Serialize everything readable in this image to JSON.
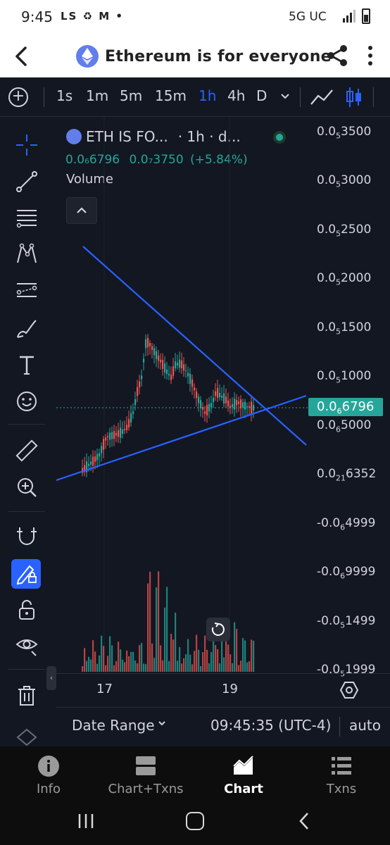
{
  "status_bar": {
    "time": "9:45",
    "notifications": "LS ♻ M •",
    "network": "5G UC"
  },
  "header": {
    "title": "Ethereum is for everyone",
    "back_icon": "back-arrow-icon",
    "share_icon": "share-icon",
    "more_icon": "more-vertical-icon"
  },
  "timeframes": {
    "items": [
      "1s",
      "1m",
      "5m",
      "15m",
      "1h",
      "4h",
      "D"
    ],
    "active": "1h",
    "dropdown_icon": "chevron-down-icon",
    "chart_type_icons": [
      "line-chart-icon",
      "candlestick-icon"
    ]
  },
  "toolbar": {
    "tools": [
      "crosshair-icon",
      "trend-line-icon",
      "fib-levels-icon",
      "pattern-icon",
      "forecast-icon",
      "brush-icon",
      "text-icon",
      "emoji-icon",
      "ruler-icon",
      "zoom-in-icon",
      "magnet-icon",
      "lock-drawing-icon",
      "unlock-icon",
      "eye-icon",
      "trash-icon"
    ]
  },
  "legend": {
    "symbol": "ETH IS FO...",
    "interval": "· 1h · d...",
    "price": "0.0₆6796",
    "change_abs": "0.0₇3750",
    "change_pct": "(+5.84%)",
    "indicator": "Volume"
  },
  "price_axis": {
    "labels": [
      {
        "main": "0.0",
        "sub": "5",
        "tail": "3500"
      },
      {
        "main": "0.0",
        "sub": "5",
        "tail": "3000"
      },
      {
        "main": "0.0",
        "sub": "5",
        "tail": "2500"
      },
      {
        "main": "0.0",
        "sub": "5",
        "tail": "2000"
      },
      {
        "main": "0.0",
        "sub": "5",
        "tail": "1500"
      },
      {
        "main": "0.0",
        "sub": "5",
        "tail": "1000"
      },
      {
        "main": "0.0",
        "sub": "6",
        "tail": "5000"
      },
      {
        "main": "0.0",
        "sub": "21",
        "tail": "6352"
      },
      {
        "main": "-0.0",
        "sub": "6",
        "tail": "4999"
      },
      {
        "main": "-0.0",
        "sub": "6",
        "tail": "9999"
      },
      {
        "main": "-0.0",
        "sub": "5",
        "tail": "1499"
      },
      {
        "main": "-0.0",
        "sub": "5",
        "tail": "1999"
      }
    ],
    "current": {
      "main": "0.0",
      "sub": "6",
      "tail": "6796"
    }
  },
  "time_axis": {
    "labels": [
      "17",
      "19"
    ]
  },
  "footer": {
    "date_range": "Date Range",
    "clock": "09:45:35 (UTC-4)",
    "scale": "auto"
  },
  "bottom_nav": {
    "items": [
      {
        "label": "Info",
        "icon": "info-icon"
      },
      {
        "label": "Chart+Txns",
        "icon": "split-view-icon"
      },
      {
        "label": "Chart",
        "icon": "area-chart-icon"
      },
      {
        "label": "Txns",
        "icon": "list-icon"
      }
    ],
    "active": "Chart"
  },
  "colors": {
    "up": "#26a69a",
    "down": "#ef5350",
    "trendline": "#2962ff",
    "accent": "#2962ff",
    "bg": "#131722"
  }
}
